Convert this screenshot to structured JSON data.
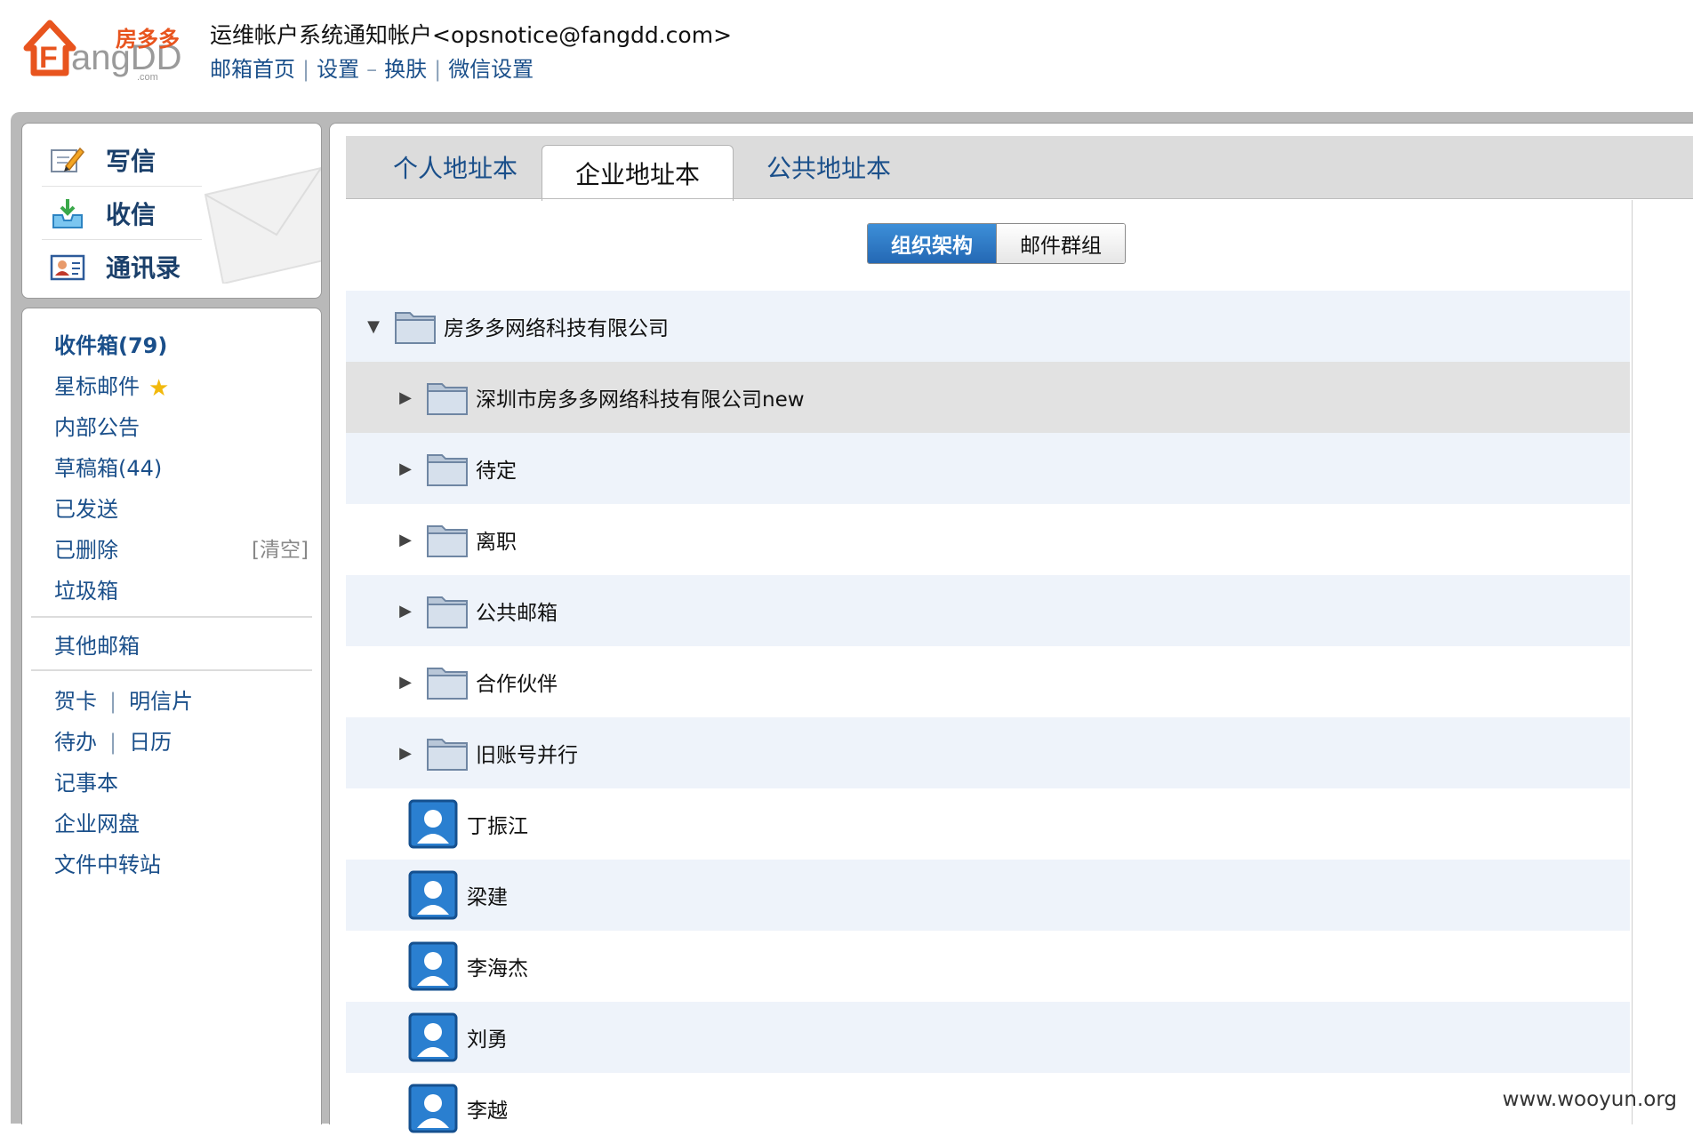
{
  "header": {
    "brand": "房多多",
    "account": "运维帐户系统通知帐户<opsnotice@fangdd.com>",
    "links": [
      {
        "label": "邮箱首页"
      },
      {
        "label": "设置"
      },
      {
        "label": "换肤"
      },
      {
        "label": "微信设置"
      }
    ],
    "sep_pipe": "|",
    "sep_dash": "–"
  },
  "quick": {
    "compose": "写信",
    "receive": "收信",
    "contacts": "通讯录"
  },
  "nav": {
    "inbox": "收件箱(79)",
    "starred": "星标邮件",
    "notices": "内部公告",
    "drafts": "草稿箱(44)",
    "sent": "已发送",
    "deleted": "已删除",
    "clear": "[清空]",
    "spam": "垃圾箱",
    "other": "其他邮箱",
    "greeting_card": "贺卡",
    "postcard": "明信片",
    "todo": "待办",
    "calendar": "日历",
    "notepad": "记事本",
    "disk": "企业网盘",
    "transfer": "文件中转站",
    "pipe": "|"
  },
  "tabs": [
    {
      "label": "个人地址本"
    },
    {
      "label": "企业地址本"
    },
    {
      "label": "公共地址本"
    }
  ],
  "segment": {
    "org": "组织架构",
    "groups": "邮件群组"
  },
  "tree": {
    "root": "房多多网络科技有限公司",
    "folders": [
      "深圳市房多多网络科技有限公司new",
      "待定",
      "离职",
      "公共邮箱",
      "合作伙伴",
      "旧账号并行"
    ],
    "people": [
      "丁振江",
      "梁建",
      "李海杰",
      "刘勇",
      "李越"
    ]
  },
  "watermark": "www.wooyun.org",
  "colors": {
    "link": "#1a4f8a",
    "accent": "#2468b4",
    "row_alt": "#eef3fa",
    "row_selected": "#e2e2e2"
  }
}
